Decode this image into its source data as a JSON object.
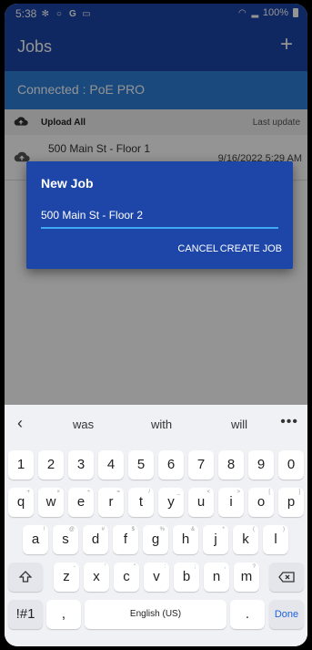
{
  "status_bar": {
    "time": "5:38",
    "left_icons": [
      "gear-icon",
      "circle-icon",
      "g-icon",
      "cast-icon"
    ],
    "battery_percent": "100%"
  },
  "app_bar": {
    "title": "Jobs",
    "add_label": "+"
  },
  "connection": {
    "text": "Connected : PoE PRO"
  },
  "upload": {
    "upload_all_label": "Upload All",
    "last_update_label": "Last update"
  },
  "jobs": [
    {
      "name": "500 Main St - Floor 1",
      "date": "9/16/2022 5:29 AM"
    }
  ],
  "dialog": {
    "title": "New Job",
    "input_value": "500 Main St - Floor 2",
    "cancel_label": "CANCEL",
    "create_label": "CREATE JOB"
  },
  "keyboard": {
    "suggestions": [
      "was",
      "with",
      "will"
    ],
    "back_icon": "chevron-left-icon",
    "more_label": "•••",
    "number_row": [
      "1",
      "2",
      "3",
      "4",
      "5",
      "6",
      "7",
      "8",
      "9",
      "0"
    ],
    "row1": [
      "q",
      "w",
      "e",
      "r",
      "t",
      "y",
      "u",
      "i",
      "o",
      "p"
    ],
    "row1_sub": [
      "+",
      "×",
      "÷",
      "=",
      "/",
      "_",
      "<",
      ">",
      "[",
      "]"
    ],
    "row2": [
      "a",
      "s",
      "d",
      "f",
      "g",
      "h",
      "j",
      "k",
      "l"
    ],
    "row2_sub": [
      "!",
      "@",
      "#",
      "$",
      "%",
      "&",
      "*",
      "(",
      ")"
    ],
    "row3": [
      "z",
      "x",
      "c",
      "v",
      "b",
      "n",
      "m"
    ],
    "row3_sub": [
      "-",
      "'",
      "\"",
      ":",
      ";",
      ",",
      "?"
    ],
    "shift_icon": "shift-icon",
    "backspace_icon": "backspace-icon",
    "symbols_label": "!#1",
    "comma_label": ",",
    "space_label": "English (US)",
    "period_label": ".",
    "done_label": "Done"
  },
  "colors": {
    "primary": "#1d46a8",
    "connected_banner": "#2e7fd9",
    "input_underline": "#3fa9f5",
    "done_blue": "#1d63d8"
  }
}
